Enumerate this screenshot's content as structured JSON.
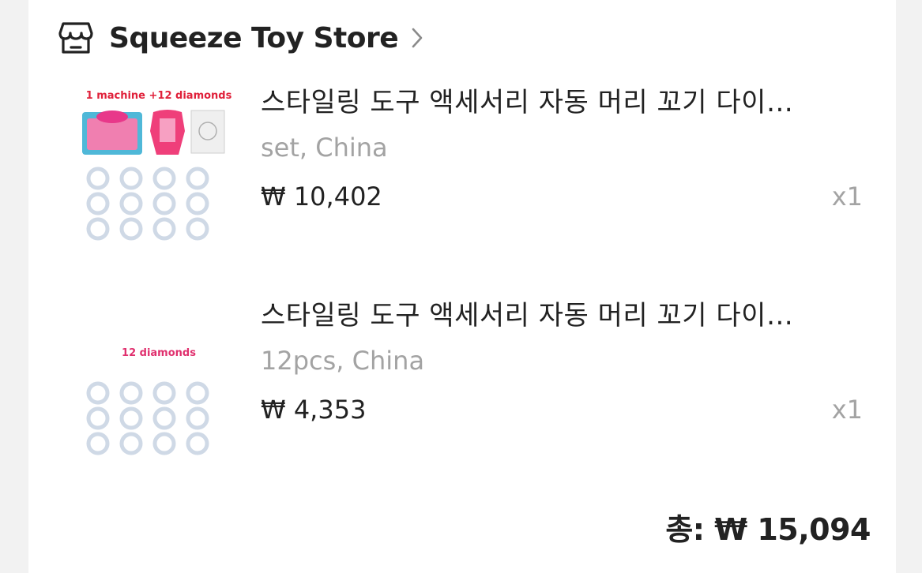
{
  "store": {
    "name": "Squeeze Toy Store",
    "icon": "store-icon",
    "chevron_icon": "chevron-right-icon"
  },
  "items": [
    {
      "image_caption": "1 machine +12 diamonds",
      "title": "스타일링 도구 액세서리 자동 머리 꼬기 다이…",
      "variant": "set, China",
      "price": "₩ 10,402",
      "qty": "x1"
    },
    {
      "image_caption": "12 diamonds",
      "title": "스타일링 도구 액세서리 자동 머리 꼬기 다이…",
      "variant": "12pcs, China",
      "price": "₩ 4,353",
      "qty": "x1"
    }
  ],
  "total": "총: ₩ 15,094",
  "colors": {
    "background": "#f2f2f2",
    "card": "#ffffff",
    "text": "#222222",
    "muted": "#a3a3a3",
    "caption_red": "#e0203a",
    "caption_pink": "#e0306e"
  }
}
